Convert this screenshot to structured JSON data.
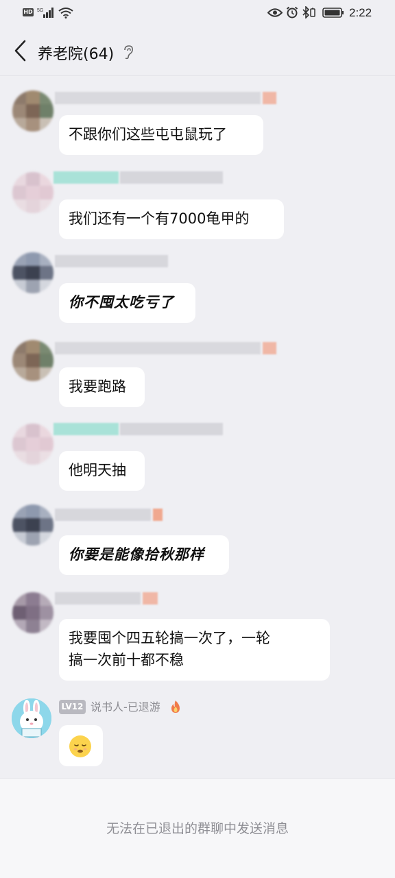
{
  "status_bar": {
    "network_badge": "HD",
    "time": "2:22",
    "icons": [
      "hd-icon",
      "signal-icon",
      "wifi-icon",
      "eye-icon",
      "alarm-icon",
      "bluetooth-icon",
      "battery-icon"
    ]
  },
  "header": {
    "title": "养老院(64)",
    "icons": [
      "back-icon",
      "ear-icon"
    ]
  },
  "messages": [
    {
      "text": "不跟你们这些屯屯鼠玩了"
    },
    {
      "text": "我们还有一个有7000龟甲的"
    },
    {
      "text": "你不囤太吃亏了"
    },
    {
      "text": "我要跑路"
    },
    {
      "text": "他明天抽"
    },
    {
      "text": "你要是能像拾秋那样"
    },
    {
      "text": "我要囤个四五轮搞一次了，一轮\n搞一次前十都不稳"
    }
  ],
  "last_sender": {
    "level": "LV12",
    "name": "说书人-已退游",
    "avatar_text": "Rabbit",
    "message_icon": "sleepy-face-emoji"
  },
  "footer": {
    "notice": "无法在已退出的群聊中发送消息"
  },
  "colors": {
    "background": "#efeff3",
    "bubble": "#ffffff",
    "footer_text": "#8f8f95",
    "level_badge": "#b9b9c0"
  }
}
